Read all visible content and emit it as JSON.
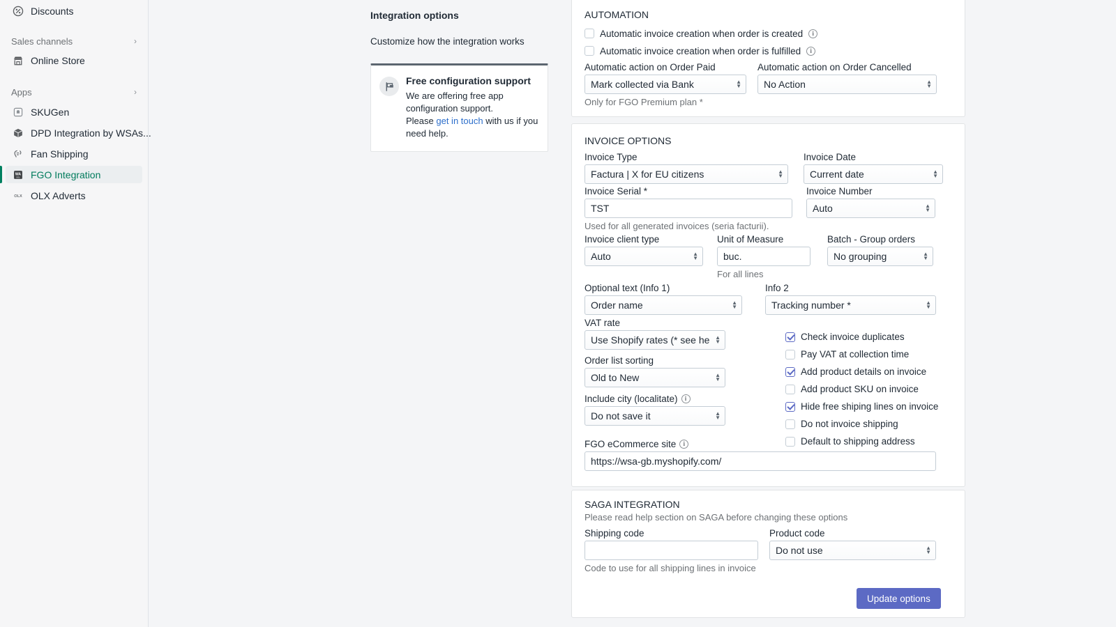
{
  "sidebar": {
    "top_item": {
      "label": "Discounts",
      "icon": "discount-icon"
    },
    "sections": [
      {
        "label": "Sales channels",
        "chevron": "›"
      },
      {
        "label": "Apps",
        "chevron": "›"
      }
    ],
    "sales_channels": [
      {
        "label": "Online Store",
        "icon": "store-icon"
      }
    ],
    "apps": [
      {
        "label": "SKUGen",
        "icon": "skugen-icon",
        "selected": false
      },
      {
        "label": "DPD Integration by WSAs...",
        "icon": "box-icon",
        "selected": false
      },
      {
        "label": "Fan Shipping",
        "icon": "fan-shipping-icon",
        "selected": false
      },
      {
        "label": "FGO Integration",
        "icon": "wa-icon",
        "selected": true
      },
      {
        "label": "OLX Adverts",
        "icon": "olx-icon",
        "selected": false
      }
    ],
    "selected_color": "#007b5c"
  },
  "middle": {
    "title": "Integration options",
    "subtitle": "Customize how the integration works",
    "promo": {
      "icon": "flag-icon",
      "heading": "Free configuration support",
      "line1": "We are offering free app",
      "line2": "configuration support.",
      "line3_prefix": "Please ",
      "link": "get in touch",
      "line3_suffix": " with us if you",
      "line4": "need help."
    }
  },
  "automation": {
    "title": "AUTOMATION",
    "checkboxes": [
      {
        "label": "Automatic invoice creation when order is created",
        "checked": false,
        "info": true
      },
      {
        "label": "Automatic invoice creation when order is fulfilled",
        "checked": false,
        "info": true
      }
    ],
    "order_paid": {
      "label": "Automatic action on Order Paid",
      "value": "Mark collected via Bank"
    },
    "order_cancelled": {
      "label": "Automatic action on Order Cancelled",
      "value": "No Action"
    },
    "footnote": "Only for FGO Premium plan *"
  },
  "invoice": {
    "title": "INVOICE OPTIONS",
    "invoice_type": {
      "label": "Invoice Type",
      "value": "Factura | X for EU citizens"
    },
    "invoice_date": {
      "label": "Invoice Date",
      "value": "Current date"
    },
    "invoice_serial": {
      "label": "Invoice Serial *",
      "value": "TST",
      "help": "Used for all generated invoices (seria facturii)."
    },
    "invoice_number": {
      "label": "Invoice Number",
      "value": "Auto"
    },
    "client_type": {
      "label": "Invoice client type",
      "value": "Auto"
    },
    "unit_of_measure": {
      "label": "Unit of Measure",
      "value": "buc.",
      "help": "For all lines"
    },
    "batch": {
      "label": "Batch - Group orders",
      "value": "No grouping"
    },
    "info1": {
      "label": "Optional text (Info 1)",
      "value": "Order name"
    },
    "info2": {
      "label": "Info 2",
      "value": "Tracking number *"
    },
    "vat_rate": {
      "label": "VAT rate",
      "value": "Use Shopify rates (* see help)"
    },
    "order_sorting": {
      "label": "Order list sorting",
      "value": "Old to New"
    },
    "include_city": {
      "label": "Include city (localitate)",
      "value": "Do not save it",
      "info": true
    },
    "ecommerce_site": {
      "label": "FGO eCommerce site",
      "value": "https://wsa-gb.myshopify.com/",
      "info": true
    },
    "checkboxes": [
      {
        "label": "Check invoice duplicates",
        "checked": true
      },
      {
        "label": "Pay VAT at collection time",
        "checked": false
      },
      {
        "label": "Add product details on invoice",
        "checked": true
      },
      {
        "label": "Add product SKU on invoice",
        "checked": false
      },
      {
        "label": "Hide free shiping lines on invoice",
        "checked": true
      },
      {
        "label": "Do not invoice shipping",
        "checked": false
      },
      {
        "label": "Default to shipping address",
        "checked": false
      }
    ]
  },
  "saga": {
    "title": "SAGA INTEGRATION",
    "note": "Please read help section on SAGA before changing these options",
    "shipping_code": {
      "label": "Shipping code",
      "value": "",
      "help": "Code to use for all shipping lines in invoice"
    },
    "product_code": {
      "label": "Product code",
      "value": "Do not use"
    },
    "submit_label": "Update options",
    "accent": "#5c6ac4"
  }
}
